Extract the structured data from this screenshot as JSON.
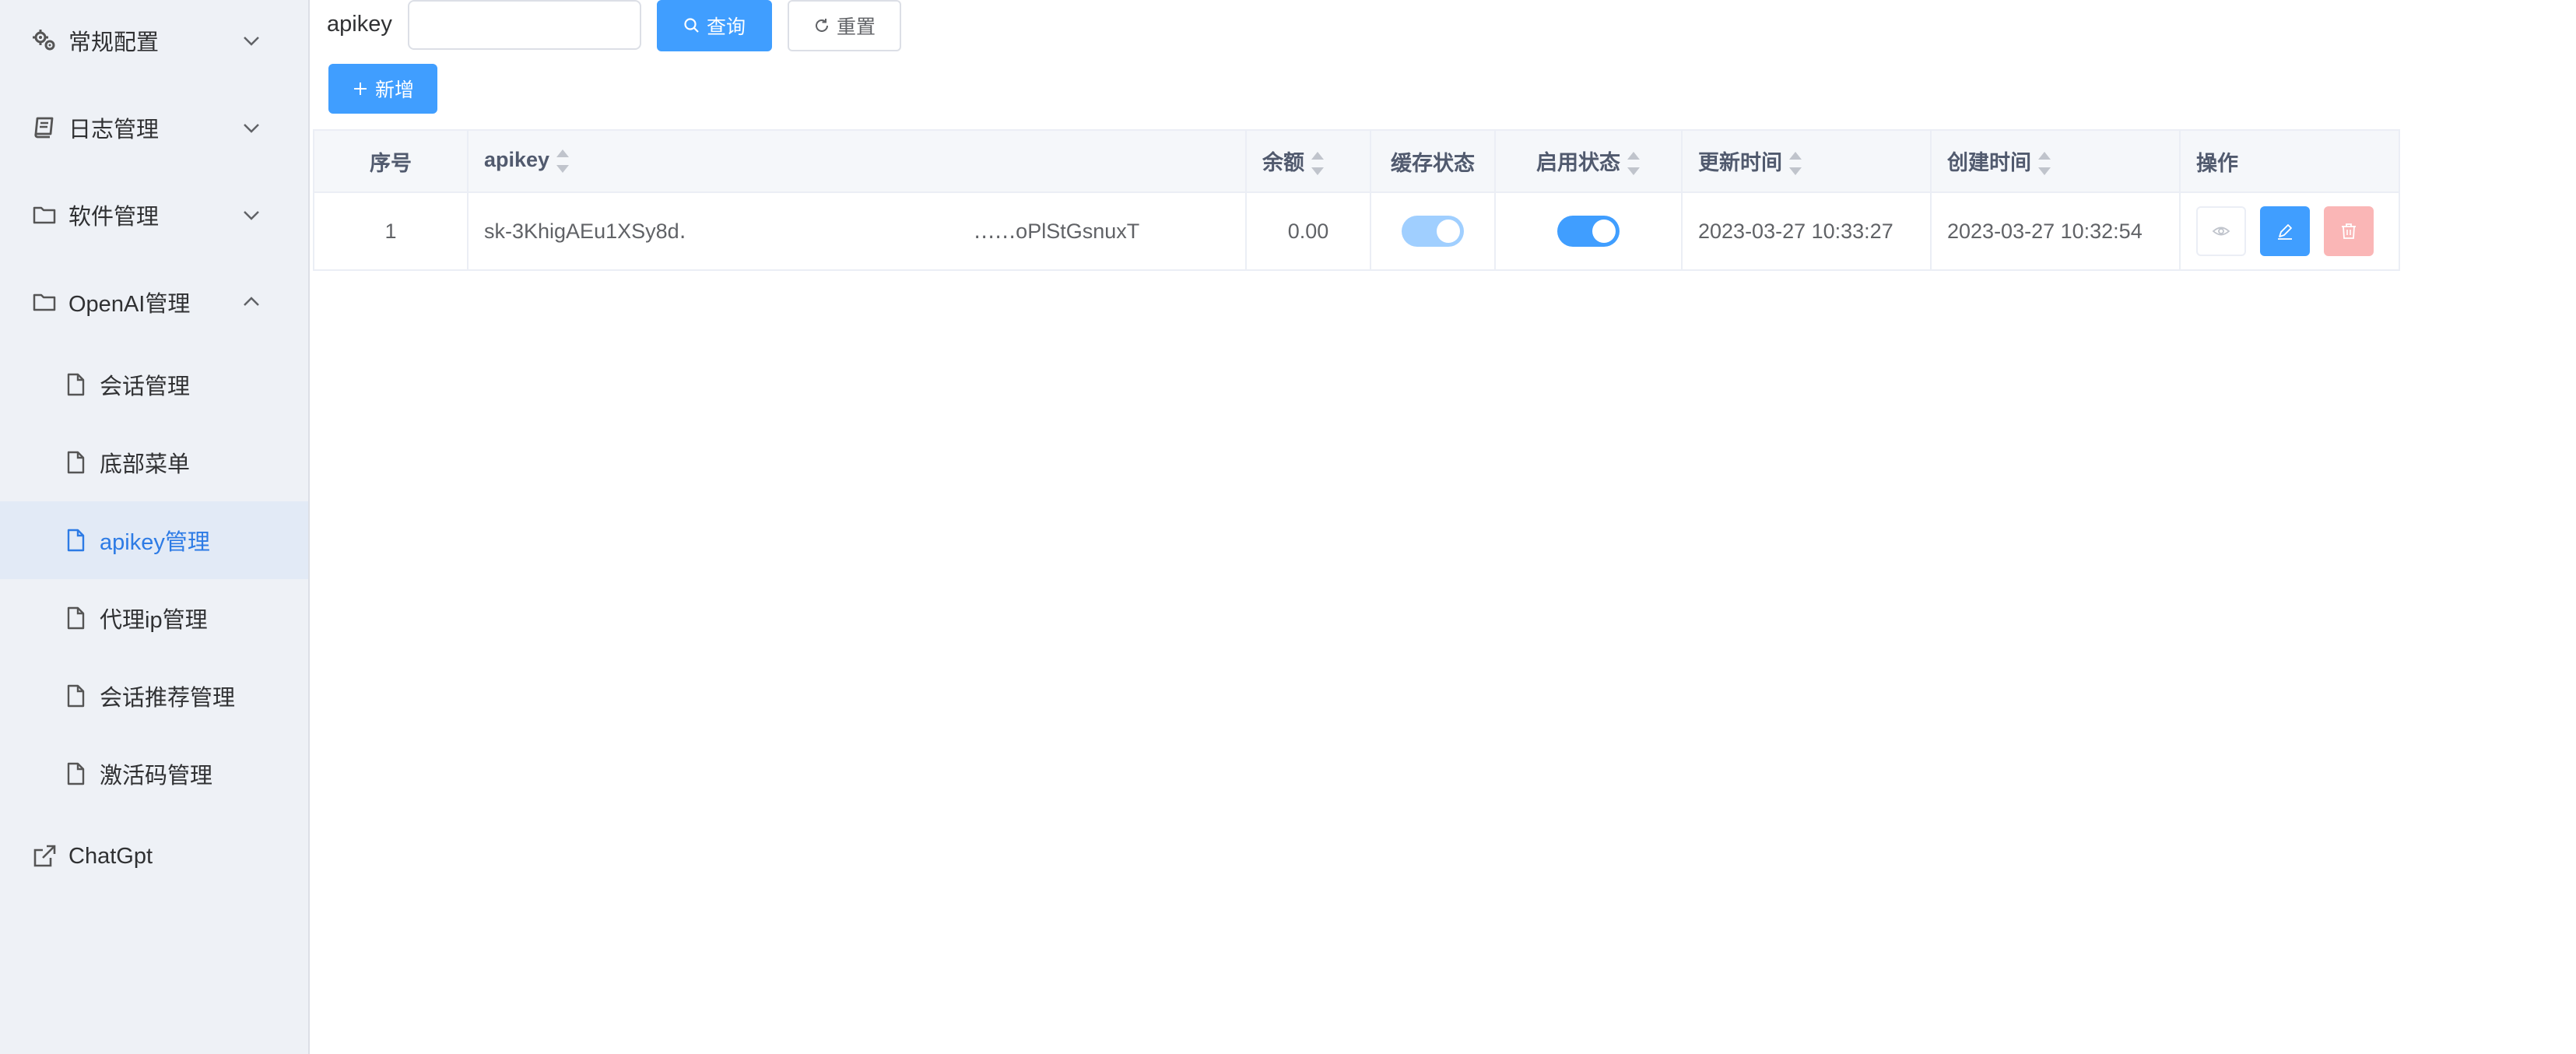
{
  "sidebar": {
    "items": [
      {
        "label": "常规配置",
        "icon": "gears-icon",
        "expanded": false
      },
      {
        "label": "日志管理",
        "icon": "book-icon",
        "expanded": false
      },
      {
        "label": "软件管理",
        "icon": "folder-icon",
        "expanded": false
      },
      {
        "label": "OpenAI管理",
        "icon": "folder-icon",
        "expanded": true
      },
      {
        "label": "ChatGpt",
        "icon": "external-link-icon"
      }
    ],
    "subitems": [
      {
        "label": "会话管理",
        "icon": "document-icon"
      },
      {
        "label": "底部菜单",
        "icon": "document-icon"
      },
      {
        "label": "apikey管理",
        "icon": "document-icon",
        "active": true
      },
      {
        "label": "代理ip管理",
        "icon": "document-icon"
      },
      {
        "label": "会话推荐管理",
        "icon": "document-icon"
      },
      {
        "label": "激活码管理",
        "icon": "document-icon"
      }
    ]
  },
  "search": {
    "label": "apikey",
    "value": "",
    "query_button": "查询",
    "reset_button": "重置",
    "add_button": "新增"
  },
  "table": {
    "headers": {
      "index": "序号",
      "apikey": "apikey",
      "balance": "余额",
      "cache_status": "缓存状态",
      "enable_status": "启用状态",
      "updated": "更新时间",
      "created": "创建时间",
      "actions": "操作"
    },
    "rows": [
      {
        "index": "1",
        "apikey": "sk-3KhigAEu1XSy8d‥‥‥‥‥‥‥‥‥‥‥‥‥‥‥‥‥‥‥‥‥‥‥‥oPlStGsnuxT",
        "balance": "0.00",
        "cache_status": true,
        "enable_status": true,
        "updated": "2023-03-27 10:33:27",
        "created": "2023-03-27 10:32:54"
      }
    ]
  },
  "colors": {
    "primary": "#409eff",
    "active_menu_text": "#2d7be5",
    "sidebar_bg": "#eef1f6",
    "danger_light": "#fab6b6",
    "switch_disabled": "#a0cfff"
  }
}
